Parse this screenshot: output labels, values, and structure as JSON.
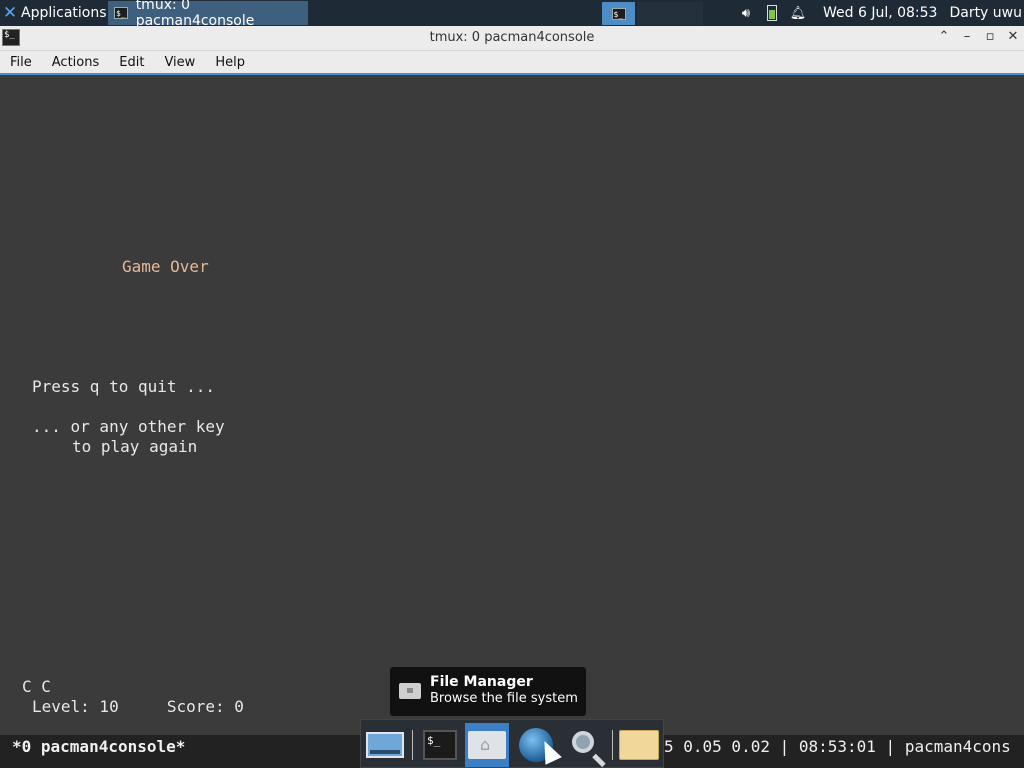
{
  "top_panel": {
    "applications_label": "Applications",
    "task_title": "tmux: 0 pacman4console",
    "clock": "Wed  6 Jul, 08:53",
    "user": "Darty uwu"
  },
  "window": {
    "title": "tmux: 0 pacman4console",
    "menu": [
      "File",
      "Actions",
      "Edit",
      "View",
      "Help"
    ]
  },
  "terminal": {
    "game_over": "Game Over",
    "press_q": "Press q to quit ...",
    "or_any": "... or any other key",
    "play_again": "to play again",
    "cc": "C C",
    "level_score": "Level: 10     Score: 0"
  },
  "status_bar": {
    "left": "*0 pacman4console*",
    "right": "5 0.05 0.02 | 08:53:01 | pacman4cons"
  },
  "tooltip": {
    "title": "File Manager",
    "subtitle": "Browse the file system"
  },
  "dock": [
    "desktop-icon",
    "terminal-icon",
    "file-manager-icon",
    "web-browser-icon",
    "search-icon",
    "folder-icon"
  ]
}
